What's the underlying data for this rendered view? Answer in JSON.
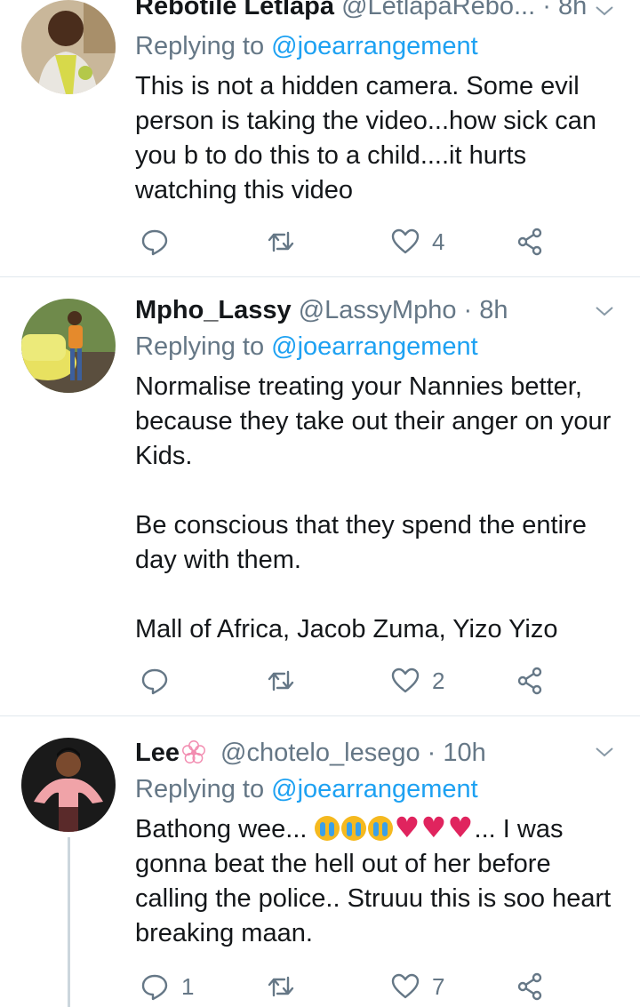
{
  "tweets": [
    {
      "name": "Rebotile Letlapa",
      "handle": "@LetlapaRebo...",
      "time": "8h",
      "replying_prefix": "Replying to",
      "replying_to": "@joearrangement",
      "text": "This is not a hidden camera. Some evil person is taking the video...how sick can you b to do this to a child....it hurts watching this video",
      "reply_count": "",
      "retweet_count": "",
      "like_count": "4"
    },
    {
      "name": "Mpho_Lassy",
      "handle": "@LassyMpho",
      "time": "8h",
      "replying_prefix": "Replying to",
      "replying_to": "@joearrangement",
      "text": "Normalise treating your Nannies better, because they take out their anger on your Kids.\n\nBe conscious that they spend the entire day with them.\n\nMall of Africa, Jacob Zuma, Yizo Yizo",
      "reply_count": "",
      "retweet_count": "",
      "like_count": "2"
    },
    {
      "name": "Lee",
      "handle": "@chotelo_lesego",
      "time": "10h",
      "replying_prefix": "Replying to",
      "replying_to": "@joearrangement",
      "text_start": "Bathong wee... ",
      "text_end": "... I was gonna beat the hell out of her before calling the police.. Struuu this is soo heart breaking maan.",
      "reply_count": "1",
      "retweet_count": "",
      "like_count": "7"
    }
  ],
  "icons": {
    "reply": "reply-icon",
    "retweet": "retweet-icon",
    "like": "heart-icon",
    "share": "share-icon",
    "more": "chevron-down-icon"
  },
  "colors": {
    "mention": "#1da1f2",
    "secondary": "#657786",
    "divider": "#e1e8ed"
  }
}
